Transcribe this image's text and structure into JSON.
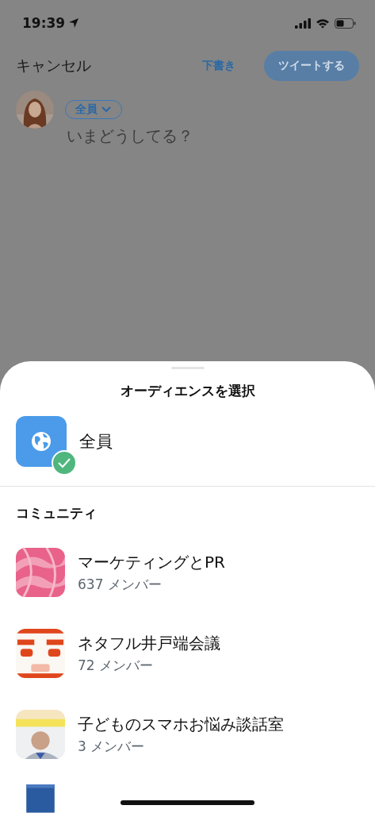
{
  "status_bar": {
    "time": "19:39"
  },
  "compose": {
    "cancel": "キャンセル",
    "drafts": "下書き",
    "tweet_button": {
      "label": "ツイートする",
      "disabled": true
    },
    "audience": "全員",
    "placeholder": "いまどうしてる？"
  },
  "sheet": {
    "title": "オーディエンスを選択",
    "everyone": {
      "label": "全員",
      "selected": true
    },
    "section_title": "コミュニティ",
    "communities": [
      {
        "name": "マーケティングとPR",
        "members": "637 メンバー",
        "selected": false
      },
      {
        "name": "ネタフル井戸端会議",
        "members": "72 メンバー",
        "selected": false
      },
      {
        "name": "子どものスマホお悩み談話室",
        "members": "3 メンバー",
        "selected": false
      }
    ]
  }
}
